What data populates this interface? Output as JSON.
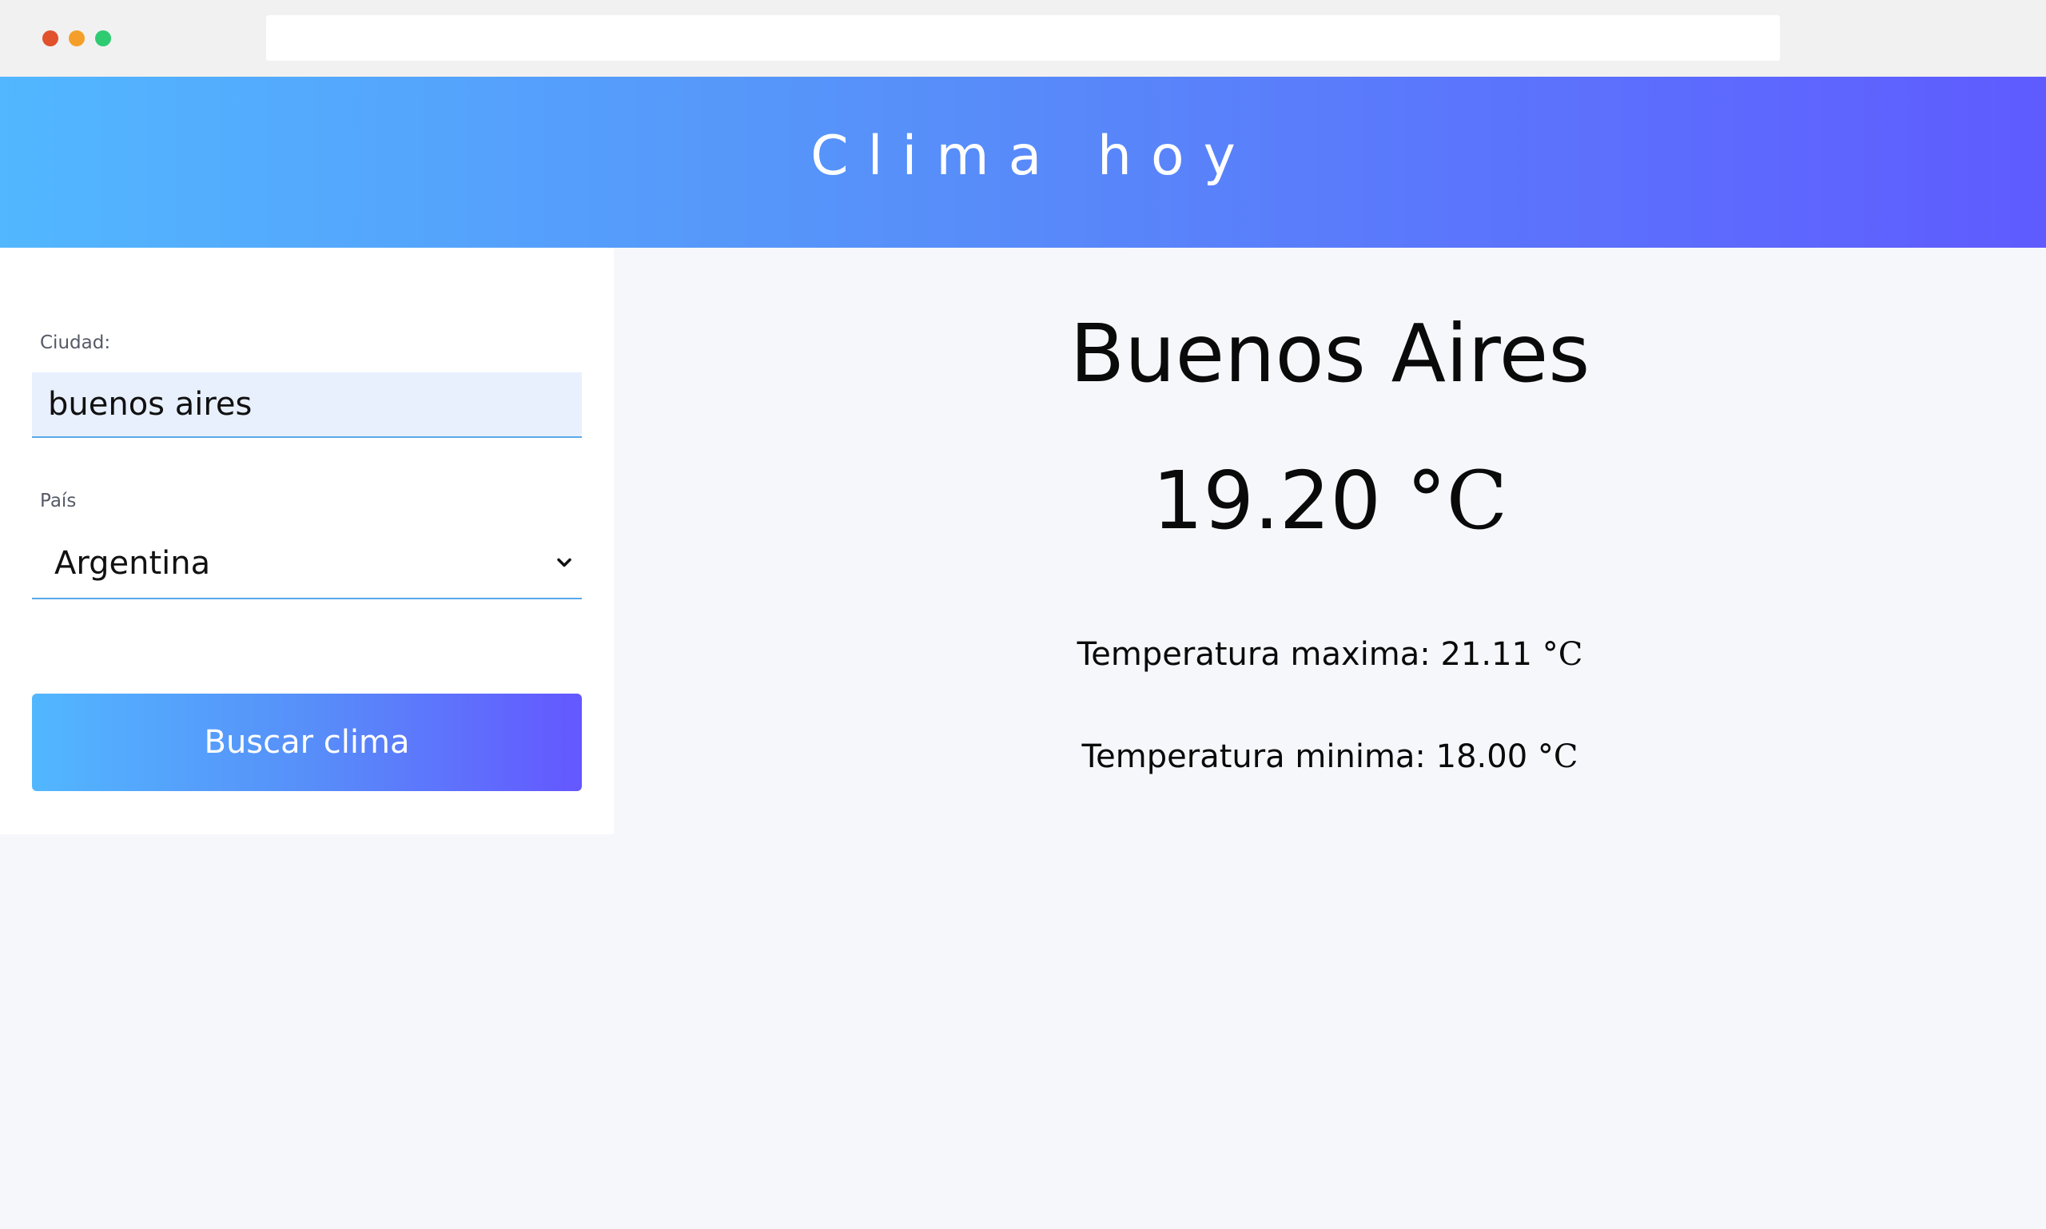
{
  "header": {
    "title": "Clima hoy"
  },
  "form": {
    "city_label": "Ciudad:",
    "city_value": "buenos aires",
    "country_label": "País",
    "country_value": "Argentina",
    "search_button": "Buscar clima"
  },
  "result": {
    "city": "Buenos Aires",
    "current_temp": "19.20",
    "max_label": "Temperatura maxima:",
    "max_temp": "21.11",
    "min_label": "Temperatura minima:",
    "min_temp": "18.00",
    "unit": "°C"
  },
  "colors": {
    "header_gradient_start": "#52b7ff",
    "header_gradient_end": "#5f5bff",
    "input_bg": "#e8f0fe",
    "underline": "#5aa8e8"
  }
}
